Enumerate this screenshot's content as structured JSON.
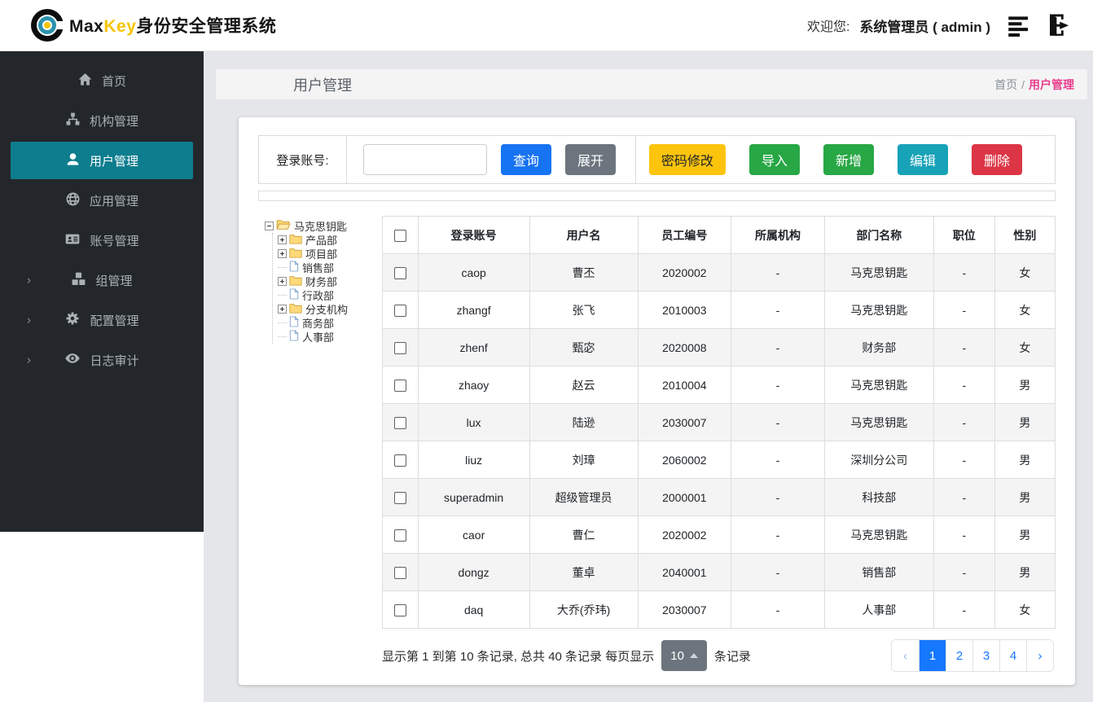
{
  "header": {
    "brand_max": "Max",
    "brand_key": "Key",
    "brand_suffix": "身份安全管理系统",
    "welcome_label": "欢迎您:",
    "user_display": "系统管理员 ( admin )"
  },
  "sidebar": {
    "items": [
      {
        "label": "首页",
        "icon": "home-icon",
        "active": false,
        "chevron": false
      },
      {
        "label": "机构管理",
        "icon": "sitemap-icon",
        "active": false,
        "chevron": false
      },
      {
        "label": "用户管理",
        "icon": "user-icon",
        "active": true,
        "chevron": false
      },
      {
        "label": "应用管理",
        "icon": "globe-icon",
        "active": false,
        "chevron": false
      },
      {
        "label": "账号管理",
        "icon": "id-card-icon",
        "active": false,
        "chevron": false
      },
      {
        "label": "组管理",
        "icon": "cubes-icon",
        "active": false,
        "chevron": true
      },
      {
        "label": "配置管理",
        "icon": "gears-icon",
        "active": false,
        "chevron": true
      },
      {
        "label": "日志审计",
        "icon": "eye-icon",
        "active": false,
        "chevron": true
      }
    ],
    "chevron_glyph": "›"
  },
  "page": {
    "title": "用户管理",
    "breadcrumb": {
      "home": "首页",
      "sep": "/",
      "current": "用户管理"
    }
  },
  "search": {
    "label": "登录账号:",
    "value": "",
    "query_label": "查询",
    "expand_label": "展开"
  },
  "actions": {
    "change_password": "密码修改",
    "import": "导入",
    "add": "新增",
    "edit": "编辑",
    "delete": "删除"
  },
  "tree": {
    "root": "马克思钥匙",
    "children": [
      {
        "label": "产品部",
        "type": "folder"
      },
      {
        "label": "项目部",
        "type": "folder"
      },
      {
        "label": "销售部",
        "type": "file"
      },
      {
        "label": "财务部",
        "type": "folder"
      },
      {
        "label": "行政部",
        "type": "file"
      },
      {
        "label": "分支机构",
        "type": "folder"
      },
      {
        "label": "商务部",
        "type": "file"
      },
      {
        "label": "人事部",
        "type": "file"
      }
    ]
  },
  "table": {
    "columns": [
      "登录账号",
      "用户名",
      "员工编号",
      "所属机构",
      "部门名称",
      "职位",
      "性别"
    ],
    "rows": [
      {
        "login": "caop",
        "name": "曹丕",
        "emp": "2020002",
        "org": "-",
        "dept": "马克思钥匙",
        "pos": "-",
        "gender": "女"
      },
      {
        "login": "zhangf",
        "name": "张飞",
        "emp": "2010003",
        "org": "-",
        "dept": "马克思钥匙",
        "pos": "-",
        "gender": "女"
      },
      {
        "login": "zhenf",
        "name": "甄宓",
        "emp": "2020008",
        "org": "-",
        "dept": "财务部",
        "pos": "-",
        "gender": "女"
      },
      {
        "login": "zhaoy",
        "name": "赵云",
        "emp": "2010004",
        "org": "-",
        "dept": "马克思钥匙",
        "pos": "-",
        "gender": "男"
      },
      {
        "login": "lux",
        "name": "陆逊",
        "emp": "2030007",
        "org": "-",
        "dept": "马克思钥匙",
        "pos": "-",
        "gender": "男"
      },
      {
        "login": "liuz",
        "name": "刘璋",
        "emp": "2060002",
        "org": "-",
        "dept": "深圳分公司",
        "pos": "-",
        "gender": "男"
      },
      {
        "login": "superadmin",
        "name": "超级管理员",
        "emp": "2000001",
        "org": "-",
        "dept": "科技部",
        "pos": "-",
        "gender": "男"
      },
      {
        "login": "caor",
        "name": "曹仁",
        "emp": "2020002",
        "org": "-",
        "dept": "马克思钥匙",
        "pos": "-",
        "gender": "男"
      },
      {
        "login": "dongz",
        "name": "董卓",
        "emp": "2040001",
        "org": "-",
        "dept": "销售部",
        "pos": "-",
        "gender": "男"
      },
      {
        "login": "daq",
        "name": "大乔(乔玮)",
        "emp": "2030007",
        "org": "-",
        "dept": "人事部",
        "pos": "-",
        "gender": "女"
      }
    ]
  },
  "footer": {
    "summary_left": "显示第 1 到第 10 条记录, 总共 40 条记录 每页显示",
    "page_size": "10",
    "summary_right": "条记录",
    "pagination": {
      "prev": "‹",
      "pages": [
        "1",
        "2",
        "3",
        "4"
      ],
      "next": "›",
      "active_page": "1"
    }
  },
  "colors": {
    "primary_blue": "#1673f2",
    "pagination_active_blue": "#1677ff",
    "success_green": "#28a745",
    "info_teal": "#17a2b8",
    "danger_red": "#dc3545",
    "warning_yellow": "#fdc40d",
    "secondary_gray": "#6c757d",
    "nav_active_teal": "#0e7d8e",
    "nav_background": "#23272b",
    "breadcrumb_pink": "#e83e8c",
    "brand_yellow": "#f7c400"
  }
}
